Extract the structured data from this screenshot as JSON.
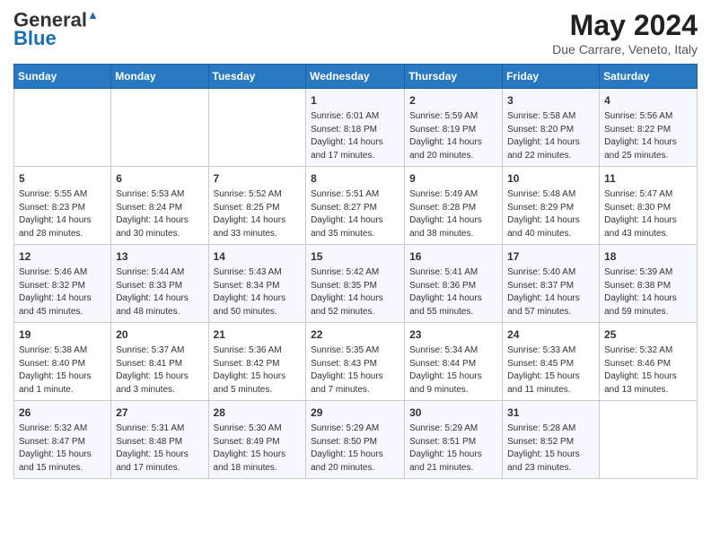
{
  "header": {
    "logo_line1": "General",
    "logo_line2": "Blue",
    "month_year": "May 2024",
    "location": "Due Carrare, Veneto, Italy"
  },
  "days_of_week": [
    "Sunday",
    "Monday",
    "Tuesday",
    "Wednesday",
    "Thursday",
    "Friday",
    "Saturday"
  ],
  "weeks": [
    [
      {
        "day": "",
        "content": ""
      },
      {
        "day": "",
        "content": ""
      },
      {
        "day": "",
        "content": ""
      },
      {
        "day": "1",
        "content": "Sunrise: 6:01 AM\nSunset: 8:18 PM\nDaylight: 14 hours and 17 minutes."
      },
      {
        "day": "2",
        "content": "Sunrise: 5:59 AM\nSunset: 8:19 PM\nDaylight: 14 hours and 20 minutes."
      },
      {
        "day": "3",
        "content": "Sunrise: 5:58 AM\nSunset: 8:20 PM\nDaylight: 14 hours and 22 minutes."
      },
      {
        "day": "4",
        "content": "Sunrise: 5:56 AM\nSunset: 8:22 PM\nDaylight: 14 hours and 25 minutes."
      }
    ],
    [
      {
        "day": "5",
        "content": "Sunrise: 5:55 AM\nSunset: 8:23 PM\nDaylight: 14 hours and 28 minutes."
      },
      {
        "day": "6",
        "content": "Sunrise: 5:53 AM\nSunset: 8:24 PM\nDaylight: 14 hours and 30 minutes."
      },
      {
        "day": "7",
        "content": "Sunrise: 5:52 AM\nSunset: 8:25 PM\nDaylight: 14 hours and 33 minutes."
      },
      {
        "day": "8",
        "content": "Sunrise: 5:51 AM\nSunset: 8:27 PM\nDaylight: 14 hours and 35 minutes."
      },
      {
        "day": "9",
        "content": "Sunrise: 5:49 AM\nSunset: 8:28 PM\nDaylight: 14 hours and 38 minutes."
      },
      {
        "day": "10",
        "content": "Sunrise: 5:48 AM\nSunset: 8:29 PM\nDaylight: 14 hours and 40 minutes."
      },
      {
        "day": "11",
        "content": "Sunrise: 5:47 AM\nSunset: 8:30 PM\nDaylight: 14 hours and 43 minutes."
      }
    ],
    [
      {
        "day": "12",
        "content": "Sunrise: 5:46 AM\nSunset: 8:32 PM\nDaylight: 14 hours and 45 minutes."
      },
      {
        "day": "13",
        "content": "Sunrise: 5:44 AM\nSunset: 8:33 PM\nDaylight: 14 hours and 48 minutes."
      },
      {
        "day": "14",
        "content": "Sunrise: 5:43 AM\nSunset: 8:34 PM\nDaylight: 14 hours and 50 minutes."
      },
      {
        "day": "15",
        "content": "Sunrise: 5:42 AM\nSunset: 8:35 PM\nDaylight: 14 hours and 52 minutes."
      },
      {
        "day": "16",
        "content": "Sunrise: 5:41 AM\nSunset: 8:36 PM\nDaylight: 14 hours and 55 minutes."
      },
      {
        "day": "17",
        "content": "Sunrise: 5:40 AM\nSunset: 8:37 PM\nDaylight: 14 hours and 57 minutes."
      },
      {
        "day": "18",
        "content": "Sunrise: 5:39 AM\nSunset: 8:38 PM\nDaylight: 14 hours and 59 minutes."
      }
    ],
    [
      {
        "day": "19",
        "content": "Sunrise: 5:38 AM\nSunset: 8:40 PM\nDaylight: 15 hours and 1 minute."
      },
      {
        "day": "20",
        "content": "Sunrise: 5:37 AM\nSunset: 8:41 PM\nDaylight: 15 hours and 3 minutes."
      },
      {
        "day": "21",
        "content": "Sunrise: 5:36 AM\nSunset: 8:42 PM\nDaylight: 15 hours and 5 minutes."
      },
      {
        "day": "22",
        "content": "Sunrise: 5:35 AM\nSunset: 8:43 PM\nDaylight: 15 hours and 7 minutes."
      },
      {
        "day": "23",
        "content": "Sunrise: 5:34 AM\nSunset: 8:44 PM\nDaylight: 15 hours and 9 minutes."
      },
      {
        "day": "24",
        "content": "Sunrise: 5:33 AM\nSunset: 8:45 PM\nDaylight: 15 hours and 11 minutes."
      },
      {
        "day": "25",
        "content": "Sunrise: 5:32 AM\nSunset: 8:46 PM\nDaylight: 15 hours and 13 minutes."
      }
    ],
    [
      {
        "day": "26",
        "content": "Sunrise: 5:32 AM\nSunset: 8:47 PM\nDaylight: 15 hours and 15 minutes."
      },
      {
        "day": "27",
        "content": "Sunrise: 5:31 AM\nSunset: 8:48 PM\nDaylight: 15 hours and 17 minutes."
      },
      {
        "day": "28",
        "content": "Sunrise: 5:30 AM\nSunset: 8:49 PM\nDaylight: 15 hours and 18 minutes."
      },
      {
        "day": "29",
        "content": "Sunrise: 5:29 AM\nSunset: 8:50 PM\nDaylight: 15 hours and 20 minutes."
      },
      {
        "day": "30",
        "content": "Sunrise: 5:29 AM\nSunset: 8:51 PM\nDaylight: 15 hours and 21 minutes."
      },
      {
        "day": "31",
        "content": "Sunrise: 5:28 AM\nSunset: 8:52 PM\nDaylight: 15 hours and 23 minutes."
      },
      {
        "day": "",
        "content": ""
      }
    ]
  ]
}
